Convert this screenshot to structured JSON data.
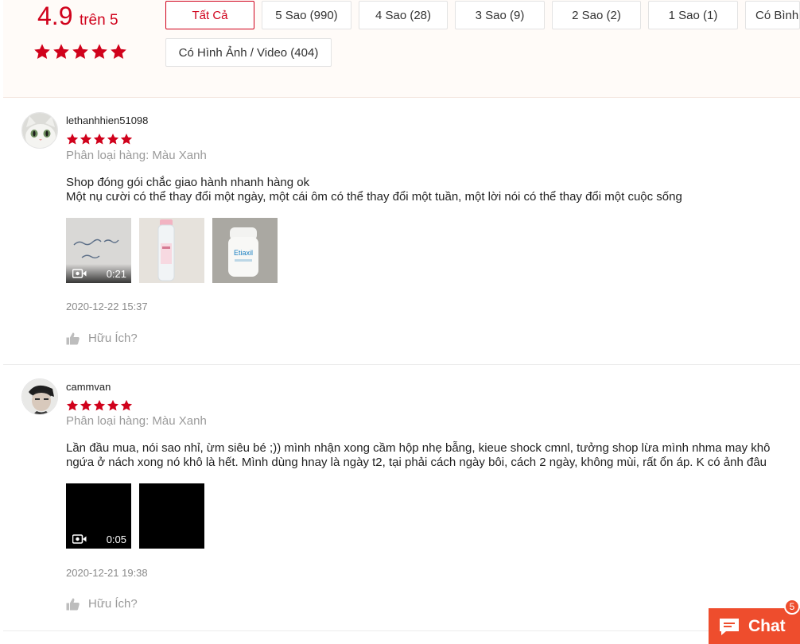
{
  "overview": {
    "score": "4.9",
    "score_suffix": "trên 5",
    "star_rating": 5,
    "filters": {
      "all": "Tất Cả",
      "five": "5 Sao (990)",
      "four": "4 Sao (28)",
      "three": "3 Sao (9)",
      "two": "2 Sao (2)",
      "one": "1 Sao (1)",
      "comment": "Có Bình",
      "media": "Có Hình Ảnh / Video (404)"
    },
    "active_filter": "all"
  },
  "reviews": [
    {
      "username": "lethanhhien51098",
      "rating": 5,
      "variant": "Phân loại hàng: Màu Xanh",
      "comment_lines": [
        "Shop đóng gói chắc giao hành nhanh hàng ok",
        "Một nụ cười có thể thay đổi một ngày, một cái ôm có thể thay đổi một tuần, một lời nói có thể thay đổi một cuộc sống"
      ],
      "media": [
        {
          "type": "video",
          "duration": "0:21",
          "handwriting": "Sản phẩm rất hài lòng"
        },
        {
          "type": "image",
          "label": ""
        },
        {
          "type": "image",
          "label": "Etiaxil"
        }
      ],
      "date": "2020-12-22 15:37",
      "helpful": "Hữu Ích?"
    },
    {
      "username": "cammvan",
      "rating": 5,
      "variant": "Phân loại hàng: Màu Xanh",
      "comment_lines": [
        "Lần đầu mua, nói sao nhỉ, ừm siêu bé ;)) mình nhận xong cầm hộp nhẹ bẫng, kieue shock cmnl, tưởng shop lừa mình nhma may khô",
        "ngứa ở nách xong nó khô là hết. Mình dùng hnay là ngày t2, tại phải cách ngày bôi, cách 2 ngày, không mùi, rất ổn áp. K có ảnh đâu"
      ],
      "media": [
        {
          "type": "video",
          "duration": "0:05"
        },
        {
          "type": "image"
        }
      ],
      "date": "2020-12-21 19:38",
      "helpful": "Hữu Ích?"
    }
  ],
  "chat": {
    "label": "Chat",
    "badge_count": "5"
  },
  "colors": {
    "accent_red": "#d0011b",
    "chat_orange": "#ee4d2d"
  }
}
